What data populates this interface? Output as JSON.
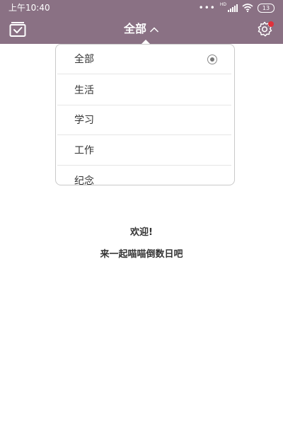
{
  "status_bar": {
    "time": "上午10:40",
    "network": "HD",
    "battery": "13"
  },
  "app_bar": {
    "title": "全部",
    "left_icon": "calendar-check-icon",
    "right_icon": "gear-icon",
    "accent_color": "#8a7184",
    "notification_dot_color": "#e0303a"
  },
  "dropdown": {
    "items": [
      {
        "label": "全部",
        "selected": true
      },
      {
        "label": "生活",
        "selected": false
      },
      {
        "label": "学习",
        "selected": false
      },
      {
        "label": "工作",
        "selected": false
      },
      {
        "label": "纪念",
        "selected": false
      }
    ]
  },
  "empty_state": {
    "welcome": "欢迎!",
    "message": "来一起喵喵倒数日吧"
  }
}
